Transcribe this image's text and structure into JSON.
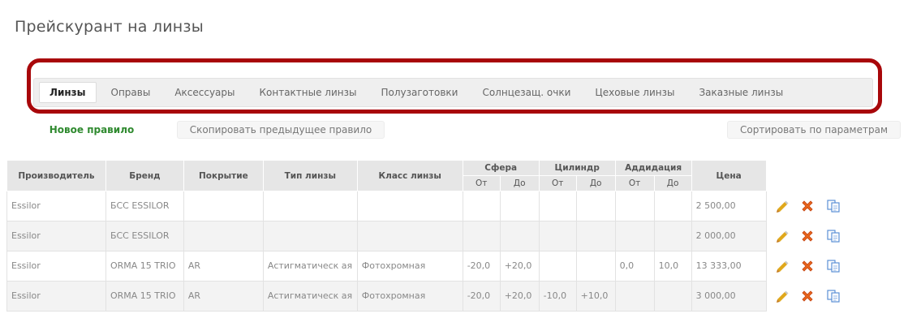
{
  "page": {
    "title": "Прейскурант на линзы"
  },
  "tabs": [
    {
      "label": "Линзы",
      "active": true
    },
    {
      "label": "Оправы",
      "active": false
    },
    {
      "label": "Аксессуары",
      "active": false
    },
    {
      "label": "Контактные линзы",
      "active": false
    },
    {
      "label": "Полузаготовки",
      "active": false
    },
    {
      "label": "Солнцезащ. очки",
      "active": false
    },
    {
      "label": "Цеховые линзы",
      "active": false
    },
    {
      "label": "Заказные линзы",
      "active": false
    }
  ],
  "toolbar": {
    "new_rule": "Новое правило",
    "copy_previous": "Скопировать предыдущее правило",
    "sort_by_params": "Сортировать по параметрам"
  },
  "table": {
    "headers": {
      "manufacturer": "Производитель",
      "brand": "Бренд",
      "coating": "Покрытие",
      "lens_type": "Тип линзы",
      "lens_class": "Класс линзы",
      "sphere": "Сфера",
      "cylinder": "Цилиндр",
      "addition": "Аддидация",
      "price": "Цена",
      "from": "От",
      "to": "До"
    },
    "rows": [
      {
        "manufacturer": "Essilor",
        "brand": "БСС ESSILOR",
        "coating": "",
        "lens_type": "",
        "lens_class": "",
        "sph_from": "",
        "sph_to": "",
        "cyl_from": "",
        "cyl_to": "",
        "add_from": "",
        "add_to": "",
        "price": "2 500,00"
      },
      {
        "manufacturer": "Essilor",
        "brand": "БСС ESSILOR",
        "coating": "",
        "lens_type": "",
        "lens_class": "",
        "sph_from": "",
        "sph_to": "",
        "cyl_from": "",
        "cyl_to": "",
        "add_from": "",
        "add_to": "",
        "price": "2 000,00"
      },
      {
        "manufacturer": "Essilor",
        "brand": "ORMA 15 TRIO",
        "coating": "AR",
        "lens_type": "Астигматическ ая",
        "lens_class": "Фотохромная",
        "sph_from": "-20,0",
        "sph_to": "+20,0",
        "cyl_from": "",
        "cyl_to": "",
        "add_from": "0,0",
        "add_to": "10,0",
        "price": "13 333,00"
      },
      {
        "manufacturer": "Essilor",
        "brand": "ORMA 15 TRIO",
        "coating": "AR",
        "lens_type": "Астигматическ ая",
        "lens_class": "Фотохромная",
        "sph_from": "-20,0",
        "sph_to": "+20,0",
        "cyl_from": "-10,0",
        "cyl_to": "+10,0",
        "add_from": "",
        "add_to": "",
        "price": "3 000,00"
      }
    ]
  },
  "icons": {
    "edit": "pencil-icon",
    "delete": "delete-x-icon",
    "copy": "copy-document-icon"
  },
  "colors": {
    "highlight_border": "#a8070a",
    "new_rule_text": "#2f8a2f",
    "edit_icon": "#e0a81c",
    "delete_icon": "#e8661c",
    "copy_icon": "#5b8fd6"
  }
}
